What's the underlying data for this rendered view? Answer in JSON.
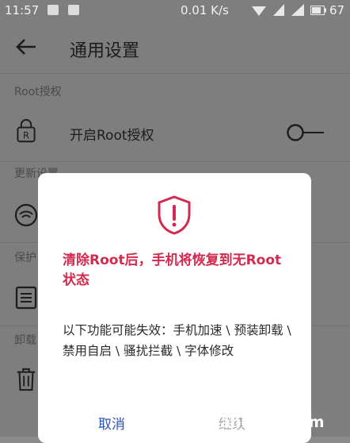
{
  "status_bar": {
    "time": "11:57",
    "network_speed": "0.01 K/s",
    "battery": "67"
  },
  "app_bar": {
    "title": "通用设置"
  },
  "sections": {
    "root": "Root授权",
    "update": "更新设置",
    "protect": "保护",
    "uninstall": "卸载"
  },
  "rows": {
    "root_toggle_label": "开启Root授权"
  },
  "dialog": {
    "title": "清除Root后，手机将恢复到无Root状态",
    "body": "以下功能可能失效：手机加速 \\ 预装卸载 \\ 禁用自启 \\ 骚扰拦截 \\ 字体修改",
    "cancel_label": "取消",
    "continue_label": "继续"
  },
  "watermark": "sichuanhong.com",
  "colors": {
    "accent": "#2d52b5",
    "warning": "#d42a4f"
  }
}
